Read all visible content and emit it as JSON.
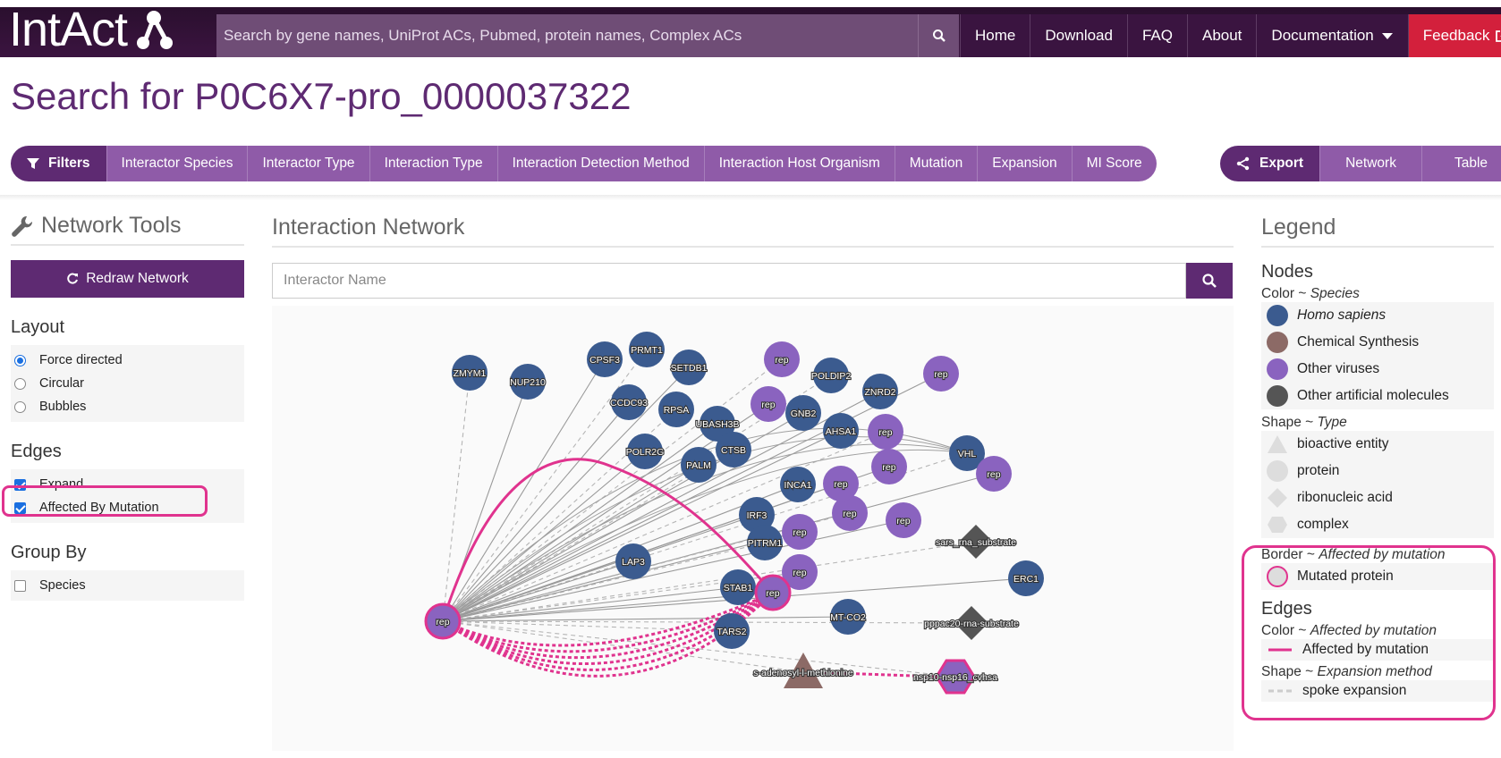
{
  "header": {
    "logo_text": "IntAct",
    "search_placeholder": "Search by gene names, UniProt ACs, Pubmed, protein names, Complex ACs",
    "nav": [
      "Home",
      "Download",
      "FAQ",
      "About",
      "Documentation",
      "Feedback"
    ]
  },
  "page": {
    "title": "Search for P0C6X7-pro_0000037322"
  },
  "filters": {
    "label": "Filters",
    "items": [
      "Interactor Species",
      "Interactor Type",
      "Interaction Type",
      "Interaction Detection Method",
      "Interaction Host Organism",
      "Mutation",
      "Expansion",
      "MI Score"
    ]
  },
  "export": {
    "label": "Export",
    "items": [
      "Network",
      "Table"
    ]
  },
  "tools": {
    "title": "Network Tools",
    "redraw": "Redraw Network",
    "layout_title": "Layout",
    "layout_options": [
      "Force directed",
      "Circular",
      "Bubbles"
    ],
    "edges_title": "Edges",
    "edge_options": [
      "Expand",
      "Affected By Mutation"
    ],
    "group_title": "Group By",
    "group_options": [
      "Species"
    ]
  },
  "network": {
    "title": "Interaction Network",
    "search_placeholder": "Interactor Name",
    "colors": {
      "human": "#3b5b8f",
      "virus": "#8a63bf",
      "chemical": "#8c6a66",
      "artificial": "#555555",
      "mutation": "#e0338e"
    },
    "nodes": [
      {
        "label": "ZMYM1",
        "kind": "human"
      },
      {
        "label": "NUP210",
        "kind": "human"
      },
      {
        "label": "CPSF3",
        "kind": "human"
      },
      {
        "label": "PRMT1",
        "kind": "human"
      },
      {
        "label": "SETDB1",
        "kind": "human"
      },
      {
        "label": "CCDC93",
        "kind": "human"
      },
      {
        "label": "RPSA",
        "kind": "human"
      },
      {
        "label": "UBASH3B",
        "kind": "human"
      },
      {
        "label": "POLR2G",
        "kind": "human"
      },
      {
        "label": "CTSB",
        "kind": "human"
      },
      {
        "label": "PALM",
        "kind": "human"
      },
      {
        "label": "GNB2",
        "kind": "human"
      },
      {
        "label": "POLDIP2",
        "kind": "human"
      },
      {
        "label": "ZNRD2",
        "kind": "human"
      },
      {
        "label": "AHSA1",
        "kind": "human"
      },
      {
        "label": "VHL",
        "kind": "human"
      },
      {
        "label": "INCA1",
        "kind": "human"
      },
      {
        "label": "IRF3",
        "kind": "human"
      },
      {
        "label": "PITRM1",
        "kind": "human"
      },
      {
        "label": "LAP3",
        "kind": "human"
      },
      {
        "label": "STAB1",
        "kind": "human"
      },
      {
        "label": "TARS2",
        "kind": "human"
      },
      {
        "label": "MT-CO2",
        "kind": "human"
      },
      {
        "label": "ERC1",
        "kind": "human"
      },
      {
        "label": "rep",
        "kind": "virus"
      },
      {
        "label": "rep",
        "kind": "virus"
      },
      {
        "label": "rep",
        "kind": "virus"
      },
      {
        "label": "rep",
        "kind": "virus"
      },
      {
        "label": "rep",
        "kind": "virus"
      },
      {
        "label": "rep",
        "kind": "virus"
      },
      {
        "label": "rep",
        "kind": "virus"
      },
      {
        "label": "rep",
        "kind": "virus"
      },
      {
        "label": "rep",
        "kind": "virus"
      },
      {
        "label": "rep",
        "kind": "virus"
      },
      {
        "label": "rep",
        "kind": "virus"
      },
      {
        "label": "rep",
        "kind": "virus",
        "mutated": true
      },
      {
        "label": "sars_rna_substrate",
        "kind": "artificial",
        "shape": "diamond"
      },
      {
        "label": "pppac20-rna-substrate",
        "kind": "artificial",
        "shape": "diamond"
      },
      {
        "label": "s-adenosyl-l-methionine",
        "kind": "chemical",
        "shape": "triangle"
      },
      {
        "label": "nsp10-nsp16_cvhsa",
        "kind": "virus",
        "shape": "hexagon",
        "mutated": true
      },
      {
        "label": "rep",
        "kind": "virus",
        "mutated": true
      }
    ]
  },
  "legend": {
    "title": "Legend",
    "nodes_title": "Nodes",
    "color_label": "Color ~ ",
    "color_key": "Species",
    "species": [
      {
        "name": "Homo sapiens",
        "italic": true,
        "color": "#3b5b8f"
      },
      {
        "name": "Chemical Synthesis",
        "italic": false,
        "color": "#8c6a66"
      },
      {
        "name": "Other viruses",
        "italic": false,
        "color": "#8a63bf"
      },
      {
        "name": "Other artificial molecules",
        "italic": false,
        "color": "#555555"
      }
    ],
    "shape_label": "Shape ~ ",
    "shape_key": "Type",
    "types": [
      "bioactive entity",
      "protein",
      "ribonucleic acid",
      "complex"
    ],
    "border_label": "Border ~ ",
    "border_key": "Affected by mutation",
    "border_item": "Mutated protein",
    "edges_title": "Edges",
    "edge_color_label": "Color ~ ",
    "edge_color_key": "Affected by mutation",
    "edge_color_item": "Affected by mutation",
    "edge_shape_label": "Shape ~ ",
    "edge_shape_key": "Expansion method",
    "edge_shape_item": "spoke expansion"
  }
}
